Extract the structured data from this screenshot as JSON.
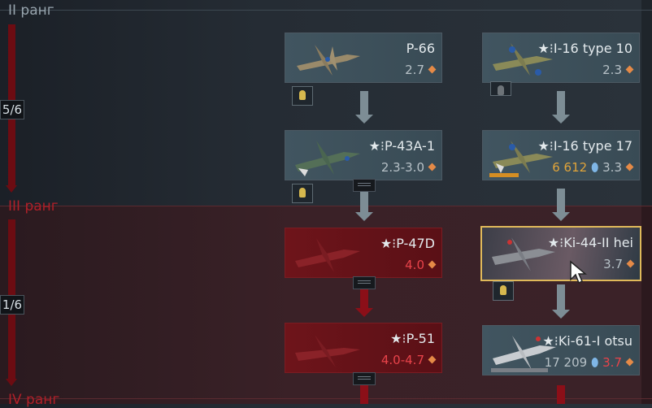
{
  "ranks": [
    {
      "label": "II ранг",
      "state": "current"
    },
    {
      "label": "III ранг",
      "state": "locked"
    },
    {
      "label": "IV ранг",
      "state": "locked"
    }
  ],
  "progress": [
    "5/6",
    "1/6"
  ],
  "vehicles": [
    {
      "name": "P-66",
      "br": "2.7",
      "rp": "",
      "style": "normal"
    },
    {
      "name": "I-16 type 10",
      "prefix": "★⁝",
      "br": "2.3",
      "rp": "",
      "style": "normal"
    },
    {
      "name": "P-43A-1",
      "prefix": "★⁝",
      "br": "2.3-3.0",
      "rp": "",
      "style": "normal"
    },
    {
      "name": "I-16 type 17",
      "prefix": "★⁝",
      "br": "3.3",
      "rp": "6 612",
      "style": "normal"
    },
    {
      "name": "P-47D",
      "prefix": "★⁝",
      "br": "4.0",
      "rp": "",
      "style": "red"
    },
    {
      "name": "Ki-44-II hei",
      "prefix": "★⁝",
      "br": "3.7",
      "rp": "",
      "style": "selected"
    },
    {
      "name": "P-51",
      "prefix": "★⁝",
      "br": "4.0-4.7",
      "rp": "",
      "style": "red"
    },
    {
      "name": "Ki-61-I otsu",
      "prefix": "★⁝",
      "br": "3.7",
      "rp": "17 209",
      "style": "normal"
    }
  ],
  "colors": {
    "accent_rp": "#e0a43a",
    "locked_red": "#b02029",
    "selected_border": "#e0b95a"
  }
}
